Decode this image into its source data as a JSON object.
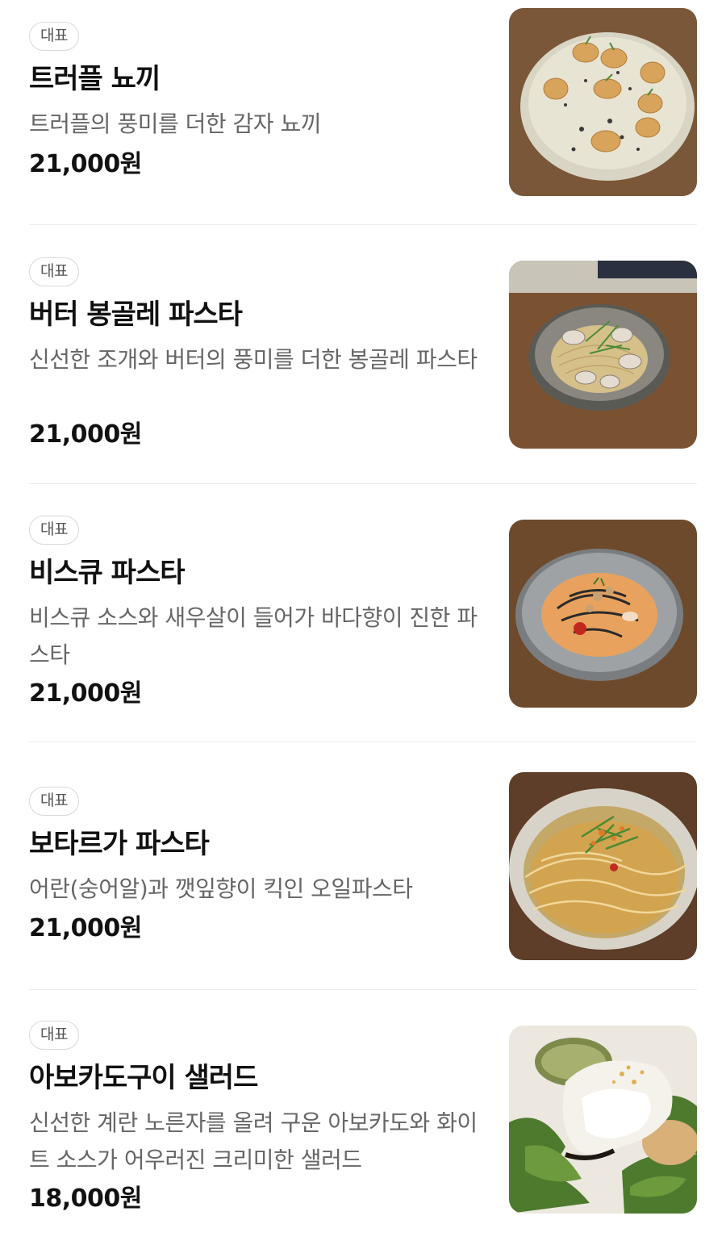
{
  "menu": {
    "items": [
      {
        "badge": "대표",
        "name": "트러플 뇨끼",
        "description": "트러플의 풍미를 더한 감자 뇨끼",
        "price": "21,000원"
      },
      {
        "badge": "대표",
        "name": "버터 봉골레 파스타",
        "description": "신선한 조개와 버터의 풍미를 더한 봉골레 파스타",
        "price": "21,000원"
      },
      {
        "badge": "대표",
        "name": "비스큐 파스타",
        "description": "비스큐 소스와 새우살이 들어가 바다향이 진한 파스타",
        "price": "21,000원"
      },
      {
        "badge": "대표",
        "name": "보타르가 파스타",
        "description": "어란(숭어알)과 깻잎향이 킥인 오일파스타",
        "price": "21,000원"
      },
      {
        "badge": "대표",
        "name": "아보카도구이 샐러드",
        "description": "신선한 계란 노른자를 올려 구운 아보카도와 화이트 소스가 어우러진 크리미한 샐러드",
        "price": "18,000원"
      }
    ]
  }
}
